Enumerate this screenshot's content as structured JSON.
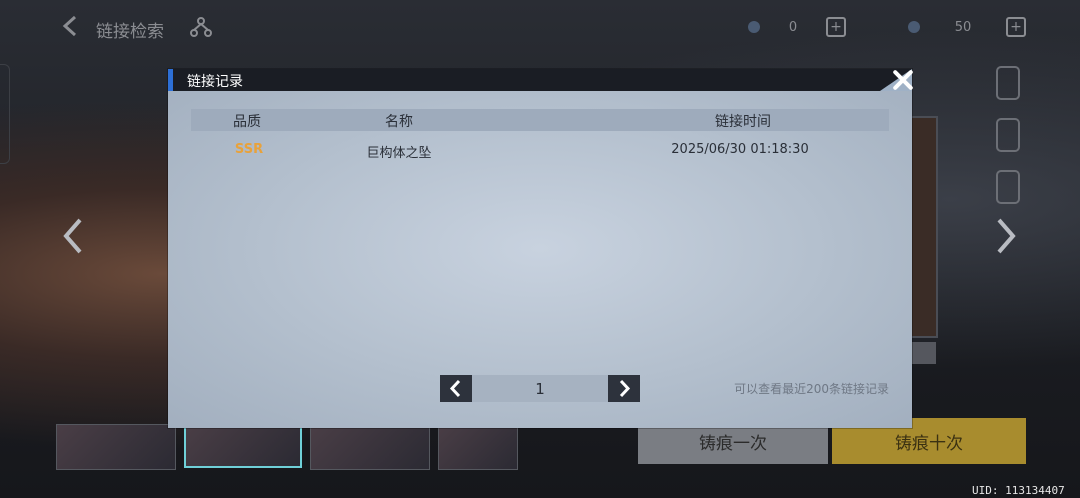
{
  "top_bar": {
    "title": "链接检索",
    "resource_1_value": "0",
    "resource_2_value": "50"
  },
  "modal": {
    "title": "链接记录",
    "columns": {
      "quality": "品质",
      "name": "名称",
      "time": "链接时间"
    },
    "rows": [
      {
        "quality": "SSR",
        "name": "巨构体之坠",
        "time": "2025/06/30 01:18:30"
      }
    ],
    "page": "1",
    "note": "可以查看最近200条链接记录"
  },
  "actions": {
    "pull_one": "铸痕一次",
    "pull_ten": "铸痕十次"
  },
  "uid": "UID: 113134407",
  "colors": {
    "accent_blue": "#2d6fd6",
    "ssr_orange": "#e8a23b",
    "modal_bg": "#b9c4d2",
    "header_dark": "#1a1d24"
  },
  "icons": [
    "back-arrow-icon",
    "tree-icon",
    "plus-icon",
    "close-icon",
    "chevron-left-icon",
    "chevron-right-icon"
  ]
}
